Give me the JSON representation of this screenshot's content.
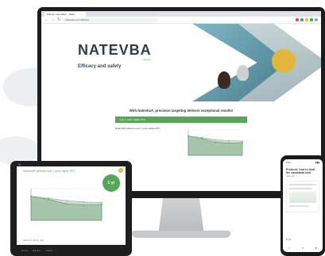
{
  "monitor": {
    "tab_label": "Efficacy and safety · Natev…",
    "url": "nateveba.com/efficacy",
    "logo_text": "NATEVBA",
    "logo_sub": "injection",
    "hero_title": "Efficacy and safety",
    "section_title": "With Natevba®, precision targeting delivers exceptional results!",
    "accordion_label": "Year 1 years visible PPC",
    "accordion_chevron": "⌄",
    "panel_text": "Natevba® delivers over 1 year visible PPC",
    "colors": {
      "accent_green": "#57a557",
      "accent_gold": "#e2b53b",
      "dark_teal": "#3d6f80"
    }
  },
  "chart_data": {
    "type": "area",
    "title": "",
    "xlabel": "",
    "ylabel": "",
    "series": [
      {
        "values": [
          3.8,
          3.3,
          2.6,
          2.4,
          2.5
        ]
      },
      {
        "values": [
          3.8,
          3.5,
          3.1,
          2.9,
          2.8
        ]
      }
    ],
    "ylim": [
      0,
      5
    ],
    "grid": true
  },
  "tablet": {
    "title": "Natevba® delivers over 1 year visible PPC",
    "badge": "1 yr",
    "close_icon": "close-icon",
    "footer": "Natevba® efficacy data",
    "bar_items": [
      "Home",
      "Efficacy",
      "Safety"
    ]
  },
  "phone": {
    "time": "9:41",
    "signal": "▮▮▮",
    "title": "Protocol: how to treat the nasolabial fold",
    "sub": "Natevba®",
    "like": "♥ 24"
  }
}
